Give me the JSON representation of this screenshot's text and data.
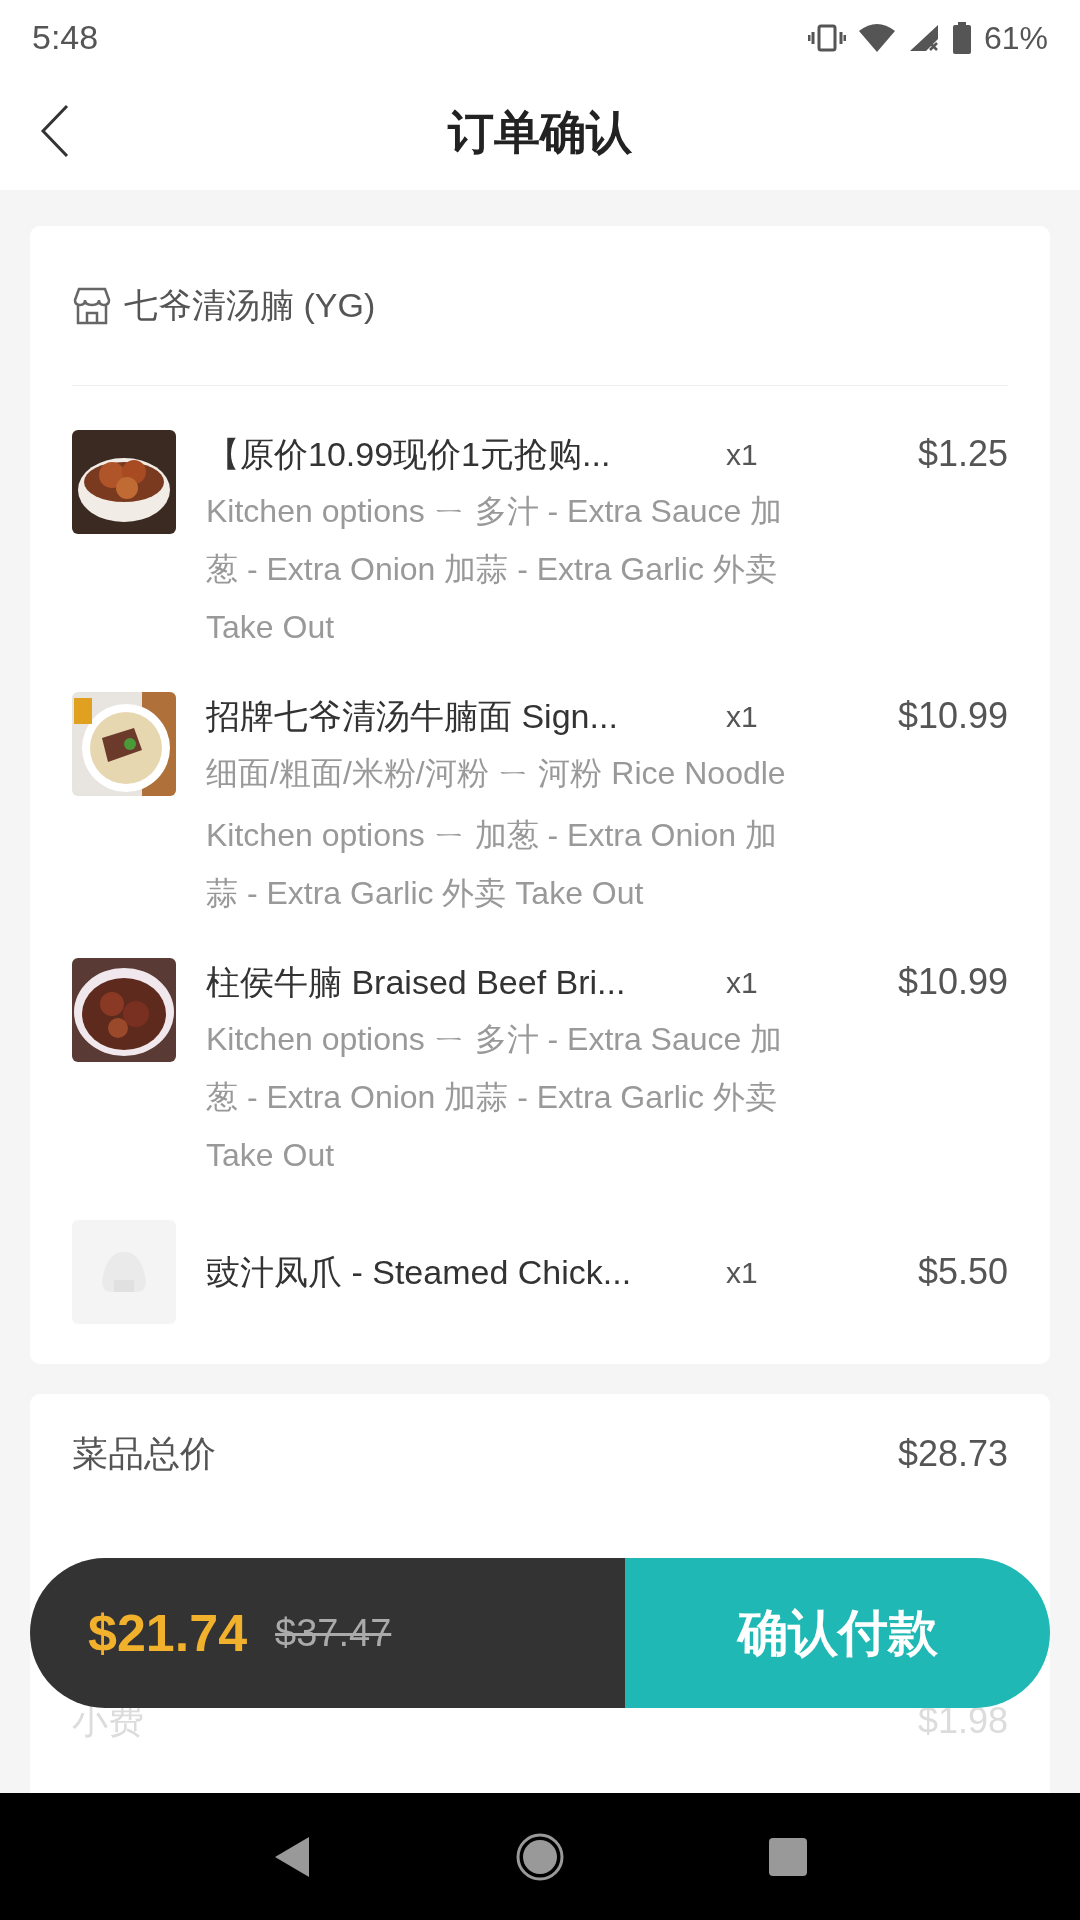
{
  "status_bar": {
    "time": "5:48",
    "battery": "61%"
  },
  "header": {
    "title": "订单确认"
  },
  "store": {
    "name": "七爷清汤腩 (YG)"
  },
  "items": [
    {
      "kind": "picture",
      "name": "【原价10.99现价1元抢购...",
      "qty": "x1",
      "price": "$1.25",
      "options": [
        "Kitchen options ㄧ 多汁 - Extra Sauce 加葱 - Extra Onion 加蒜 - Extra Garlic 外卖 Take Out"
      ]
    },
    {
      "kind": "picture",
      "name": "招牌七爷清汤牛腩面 Sign...",
      "qty": "x1",
      "price": "$10.99",
      "options": [
        "细面/粗面/米粉/河粉 ㄧ 河粉 Rice Noodle",
        "Kitchen options ㄧ 加葱 - Extra Onion 加蒜 - Extra Garlic 外卖 Take Out"
      ]
    },
    {
      "kind": "picture",
      "name": "柱侯牛腩 Braised Beef Bri...",
      "qty": "x1",
      "price": "$10.99",
      "options": [
        "Kitchen options ㄧ 多汁 - Extra Sauce 加葱 - Extra Onion 加蒜 - Extra Garlic 外卖 Take Out"
      ]
    },
    {
      "kind": "placeholder",
      "name": "豉汁凤爪 - Steamed Chick...",
      "qty": "x1",
      "price": "$5.50"
    }
  ],
  "summary": [
    {
      "label": "菜品总价",
      "value": "$28.73",
      "faded": false
    },
    {
      "label": "小费",
      "value": "$1.98",
      "faded": true
    }
  ],
  "pay_bar": {
    "total": "$21.74",
    "original": "$37.47",
    "button": "确认付款"
  }
}
